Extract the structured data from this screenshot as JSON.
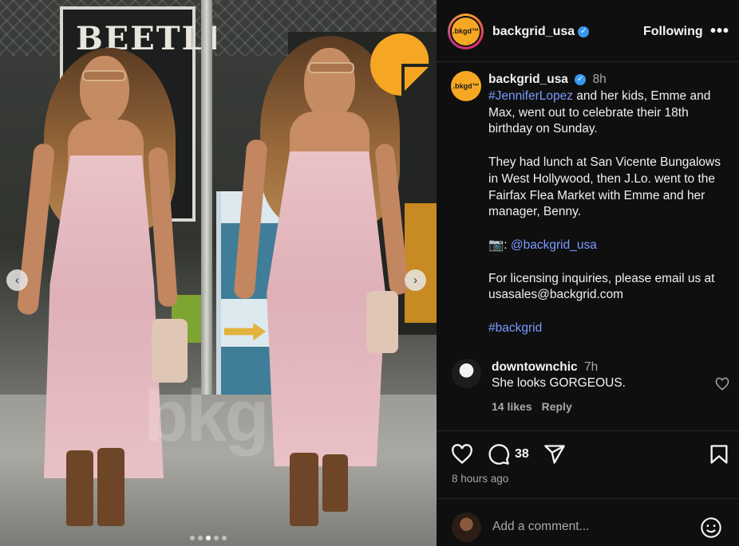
{
  "media": {
    "sign_text": "BEETLE\nLE\nE",
    "watermark": "bkg",
    "nav_prev": "‹",
    "nav_next": "›",
    "slides": [
      false,
      false,
      true,
      false,
      false
    ],
    "logo_color": "#f5a623"
  },
  "header": {
    "avatar_text": ".bkgd™",
    "username": "backgrid_usa",
    "follow_label": "Following",
    "more_label": "•••"
  },
  "caption": {
    "avatar_text": ".bkgd™",
    "username": "backgrid_usa",
    "time": "8h",
    "hashtag": "#JenniferLopez",
    "line1_rest": " and her kids, Emme and Max, went out to celebrate their 18th birthday on Sunday.",
    "para2": "They had lunch at San Vicente Bungalows in West Hollywood, then J.Lo. went to the Fairfax Flea Market with Emme and her manager, Benny.",
    "camera_prefix": "📷: ",
    "mention": "@backgrid_usa",
    "para4": "For licensing inquiries, please email us at usasales@backgrid.com",
    "tag2": "#backgrid"
  },
  "comment": {
    "username": "downtownchic",
    "time": "7h",
    "text": "She looks GORGEOUS.",
    "likes": "14 likes",
    "reply": "Reply"
  },
  "actions": {
    "comment_count": "38",
    "time_ago": "8 hours ago",
    "add_comment_placeholder": "Add a comment..."
  },
  "colors": {
    "accent_blue": "#3897f0",
    "link": "#7b9bff",
    "background": "#0f0f0f"
  }
}
